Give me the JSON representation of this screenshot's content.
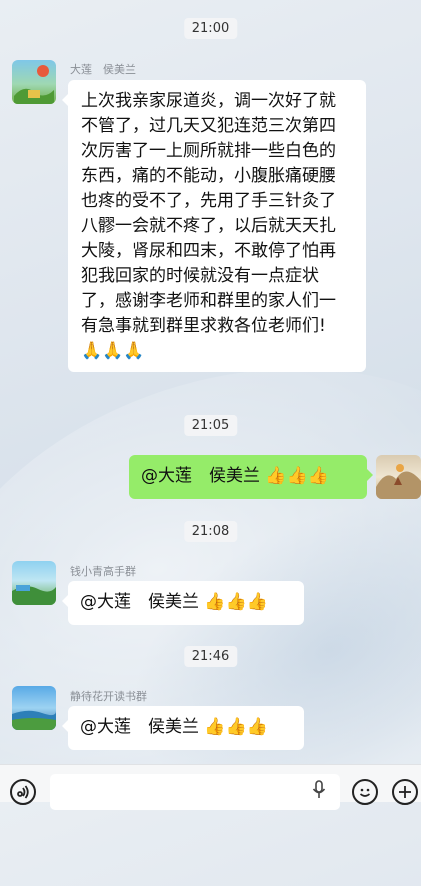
{
  "messages": [
    {
      "time": "21:00",
      "sender": "大莲　侯美兰",
      "text": "上次我亲家尿道炎，调一次好了就不管了，过几天又犯连范三次第四次厉害了一上厕所就排一些白色的东西，痛的不能动，小腹胀痛硬腰也疼的受不了，先用了手三针灸了八髎一会就不疼了，以后就天天扎大陵，肾尿和四末，不敢停了怕再犯我回家的时候就没有一点症状了，感谢李老师和群里的家人们一有急事就到群里求救各位老师们!🙏🙏🙏",
      "lines": [
        "上次我亲家尿道炎，调一次好了就",
        "不管了，过几天又犯连范三次第四",
        "次厉害了一上厕所就排一些白色的",
        "东西，痛的不能动，小腹胀痛硬腰",
        "也疼的受不了，先用了手三针灸了",
        "八髎一会就不疼了，以后就天天扎",
        "大陵，肾尿和四末，不敢停了怕再",
        "犯我回家的时候就没有一点症状",
        "了，感谢李老师和群里的家人们一",
        "有急事就到群里求救各位老师们!",
        "🙏🙏🙏"
      ]
    },
    {
      "time": "21:05",
      "text": "@大莲　侯美兰 👍👍👍"
    },
    {
      "time": "21:08",
      "sender": "钱小青高手群",
      "text": "@大莲　侯美兰 👍👍👍"
    },
    {
      "time": "21:46",
      "sender": "静待花开读书群",
      "text": "@大莲　侯美兰 👍👍👍"
    }
  ],
  "colors": {
    "own_bubble": "#95ec69",
    "other_bubble": "#ffffff"
  },
  "icons": {
    "voice": "voice-icon",
    "mic": "mic-icon",
    "emoji": "emoji-icon",
    "plus": "plus-icon"
  }
}
